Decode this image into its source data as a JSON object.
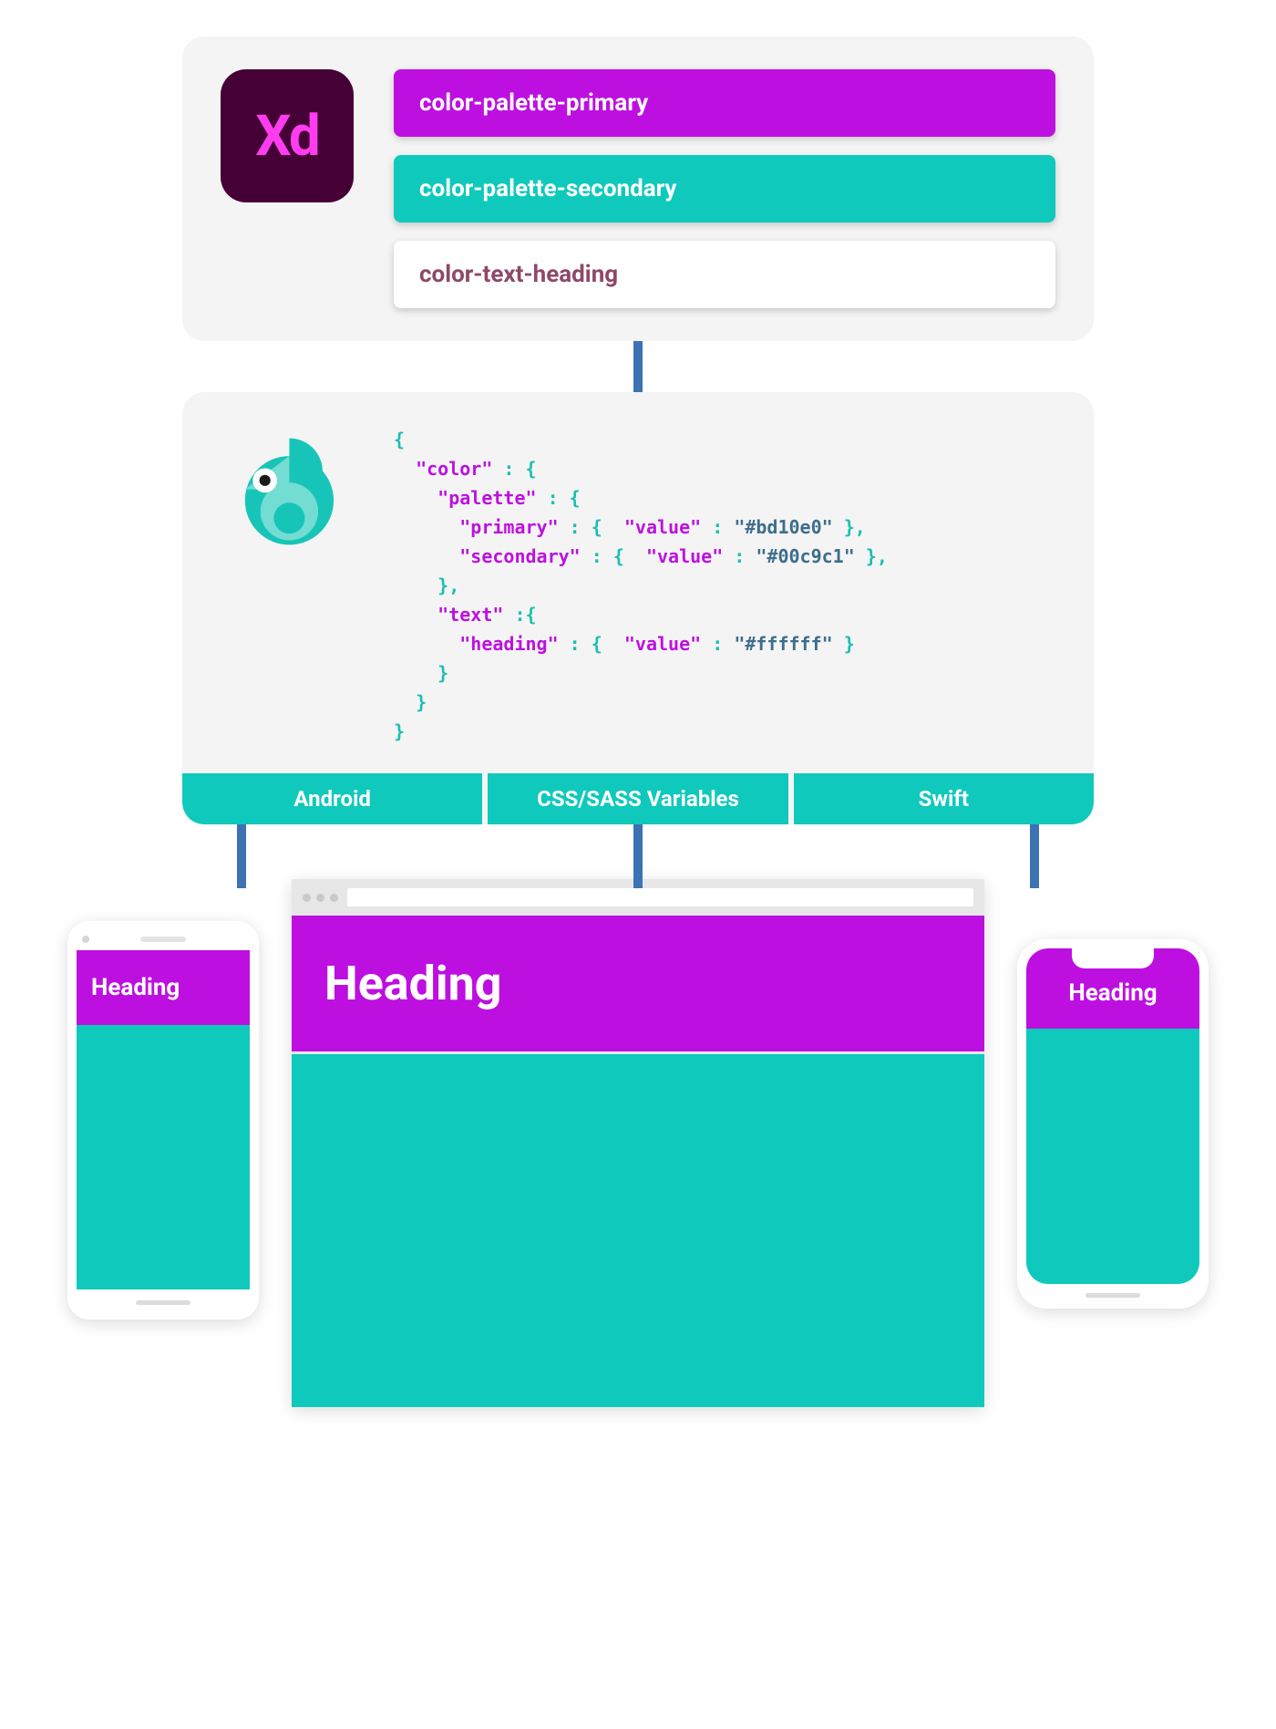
{
  "xd": {
    "label": "Xd"
  },
  "swatches": {
    "primary": {
      "label": "color-palette-primary",
      "hex": "#bd10e0"
    },
    "secondary": {
      "label": "color-palette-secondary",
      "hex": "#00c9c1"
    },
    "heading": {
      "label": "color-text-heading",
      "hex": "#ffffff"
    }
  },
  "code": {
    "open": "{",
    "color_key": "\"color\"",
    "palette_key": "\"palette\"",
    "primary_key": "\"primary\"",
    "secondary_key": "\"secondary\"",
    "text_key": "\"text\"",
    "heading_key": "\"heading\"",
    "value_key": "\"value\"",
    "primary_val": "\"#bd10e0\"",
    "secondary_val": "\"#00c9c1\"",
    "heading_val": "\"#ffffff\"",
    "colon_brace": " : {",
    "close": "}",
    "close_comma": "},"
  },
  "platforms": {
    "android": "Android",
    "css": "CSS/SASS Variables",
    "swift": "Swift"
  },
  "previews": {
    "heading": "Heading"
  },
  "colors": {
    "primary": "#bd10e0",
    "secondary": "#0fc9bc",
    "connector": "#3d72b4",
    "panel": "#f4f4f4"
  }
}
